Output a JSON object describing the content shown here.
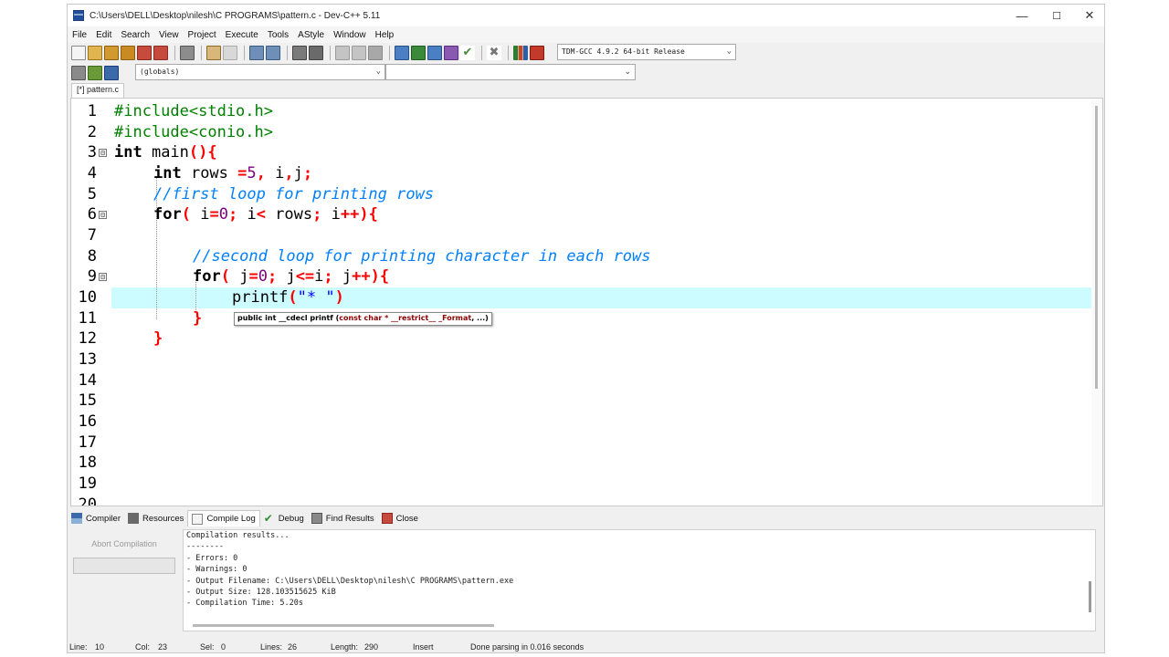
{
  "window": {
    "title": "C:\\Users\\DELL\\Desktop\\nilesh\\C PROGRAMS\\pattern.c - Dev-C++ 5.11",
    "min_glyph": "—",
    "max_glyph": "☐",
    "close_glyph": "✕"
  },
  "menu": [
    "File",
    "Edit",
    "Search",
    "View",
    "Project",
    "Execute",
    "Tools",
    "AStyle",
    "Window",
    "Help"
  ],
  "toolbar": {
    "compiler": "TDM-GCC 4.9.2 64-bit Release",
    "scope": "(globals)",
    "symbol": ""
  },
  "file_tab": "[*] pattern.c",
  "editor": {
    "lines": [
      {
        "n": "1",
        "fold": ""
      },
      {
        "n": "2",
        "fold": ""
      },
      {
        "n": "3",
        "fold": "⊟"
      },
      {
        "n": "4",
        "fold": ""
      },
      {
        "n": "5",
        "fold": ""
      },
      {
        "n": "6",
        "fold": "⊟"
      },
      {
        "n": "7",
        "fold": ""
      },
      {
        "n": "8",
        "fold": ""
      },
      {
        "n": "9",
        "fold": "⊟"
      },
      {
        "n": "10",
        "fold": ""
      },
      {
        "n": "11",
        "fold": ""
      },
      {
        "n": "12",
        "fold": ""
      },
      {
        "n": "13",
        "fold": ""
      },
      {
        "n": "14",
        "fold": ""
      },
      {
        "n": "15",
        "fold": ""
      },
      {
        "n": "16",
        "fold": ""
      },
      {
        "n": "17",
        "fold": ""
      },
      {
        "n": "18",
        "fold": ""
      },
      {
        "n": "19",
        "fold": ""
      },
      {
        "n": "20",
        "fold": ""
      }
    ],
    "current_line": 10,
    "code": {
      "l1": "#include<stdio.h>",
      "l2": "#include<conio.h>",
      "l3_kw": "int",
      "l3_rest": " main",
      "l3_sym": "(){",
      "l4_kw": "int",
      "l4_a": " rows ",
      "l4_sym1": "=",
      "l4_num": "5",
      "l4_sym2": ",",
      "l4_b": " i",
      "l4_sym3": ",",
      "l4_c": "j",
      "l4_sym4": ";",
      "l5": "//first loop for printing rows",
      "l6_kw": "for",
      "l6_s1": "(",
      "l6_a": " i",
      "l6_s2": "=",
      "l6_n": "0",
      "l6_s3": ";",
      "l6_b": " i",
      "l6_s4": "<",
      "l6_c": " rows",
      "l6_s5": ";",
      "l6_d": " i",
      "l6_s6": "++){",
      "l8": "//second loop for printing character in each rows",
      "l9_kw": "for",
      "l9_s1": "(",
      "l9_a": " j",
      "l9_s2": "=",
      "l9_n": "0",
      "l9_s3": ";",
      "l9_b": " j",
      "l9_s4": "<=",
      "l9_c": "i",
      "l9_s5": ";",
      "l9_d": " j",
      "l9_s6": "++){",
      "l10_fn": "printf",
      "l10_s1": "(",
      "l10_str": "\"* \"",
      "l10_s2": ")",
      "l11": "}",
      "l12": "}"
    },
    "tooltip": {
      "pre": "public int __cdecl printf (",
      "param": "const char * __restrict__ _Format",
      "post": ", ...)"
    }
  },
  "bottom_tabs": [
    "Compiler",
    "Resources",
    "Compile Log",
    "Debug",
    "Find Results",
    "Close"
  ],
  "active_bottom_tab": "Compile Log",
  "abort_label": "Abort Compilation",
  "log": [
    "Compilation results...",
    "--------",
    "- Errors: 0",
    "- Warnings: 0",
    "- Output Filename: C:\\Users\\DELL\\Desktop\\nilesh\\C PROGRAMS\\pattern.exe",
    "- Output Size: 128.103515625 KiB",
    "- Compilation Time: 5.20s"
  ],
  "status": {
    "line_label": "Line:",
    "line": "10",
    "col_label": "Col:",
    "col": "23",
    "sel_label": "Sel:",
    "sel": "0",
    "lines_label": "Lines:",
    "lines": "26",
    "length_label": "Length:",
    "length": "290",
    "mode": "Insert",
    "message": "Done parsing in 0.016 seconds"
  },
  "colors": {
    "current_line": "#ccfcff",
    "preprocessor": "#008000",
    "symbol": "#ff0000",
    "number": "#800080",
    "comment": "#0080ff",
    "string": "#0000ff"
  }
}
